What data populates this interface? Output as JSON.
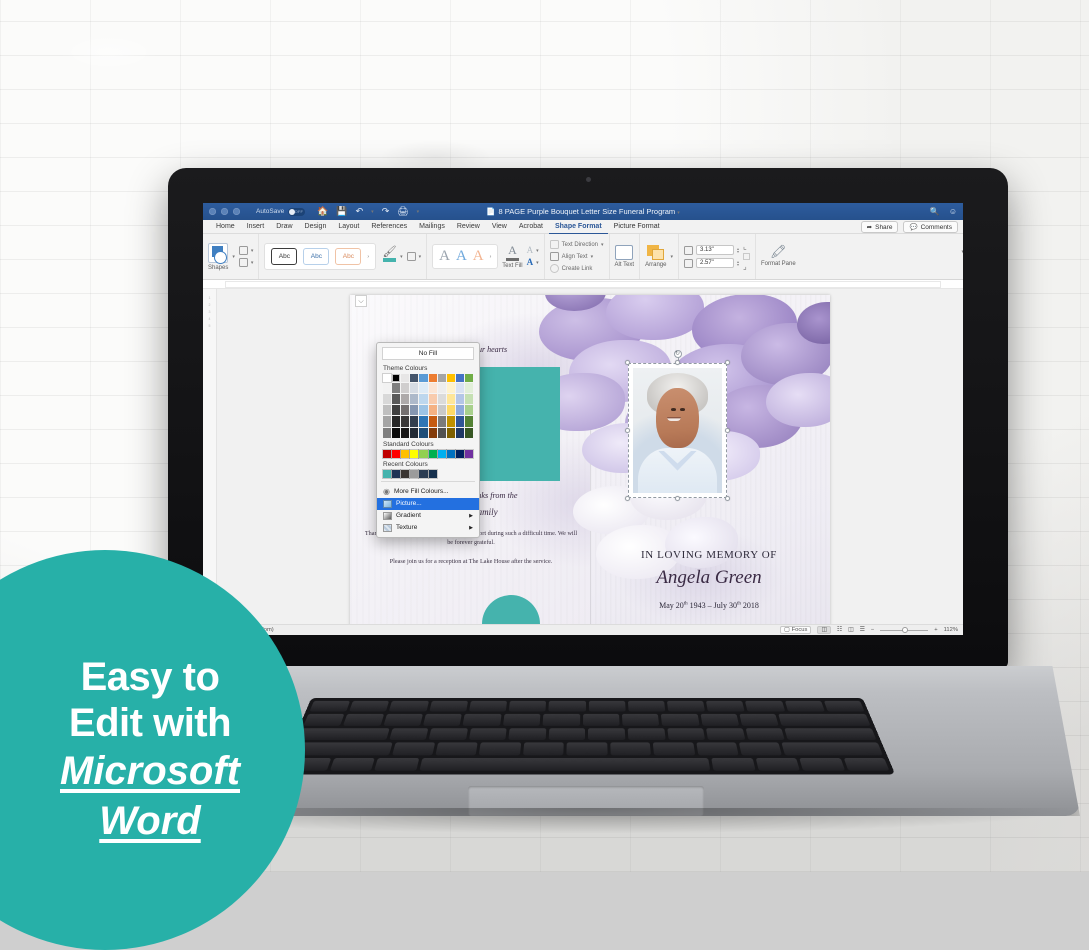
{
  "titlebar": {
    "autosave_label": "AutoSave",
    "autosave_state": "OFF",
    "document_title": "8 PAGE Purple Bouquet Letter Size Funeral Program",
    "doc_icon": "word-document-icon",
    "icons": [
      "home-icon",
      "save-icon",
      "undo-icon",
      "redo-icon",
      "print-icon",
      "customize-toolbar-icon"
    ],
    "search_icon": "search-icon",
    "account_icon": "account-icon"
  },
  "tabs": [
    {
      "label": "Home",
      "active": false
    },
    {
      "label": "Insert",
      "active": false
    },
    {
      "label": "Draw",
      "active": false
    },
    {
      "label": "Design",
      "active": false
    },
    {
      "label": "Layout",
      "active": false
    },
    {
      "label": "References",
      "active": false
    },
    {
      "label": "Mailings",
      "active": false
    },
    {
      "label": "Review",
      "active": false
    },
    {
      "label": "View",
      "active": false
    },
    {
      "label": "Acrobat",
      "active": false
    },
    {
      "label": "Shape Format",
      "active": true
    },
    {
      "label": "Picture Format",
      "active": false
    }
  ],
  "tabs_right": {
    "share_label": "Share",
    "share_icon": "share-icon",
    "comments_label": "Comments",
    "comments_icon": "comment-icon"
  },
  "ribbon": {
    "shapes_label": "Shapes",
    "edit_shape_icon": "edit-shape-icon",
    "text_box_icon": "text-box-icon",
    "shape_styles": [
      "Abc",
      "Abc",
      "Abc"
    ],
    "shape_fill_icon": "shape-fill-icon",
    "shape_outline_icon": "shape-outline-icon",
    "text_fill_label": "Text Fill",
    "wordart_letter": "A",
    "text_direction_label": "Text Direction",
    "align_text_label": "Align Text",
    "create_link_label": "Create Link",
    "alt_text_label": "Alt Text",
    "alt_text_icon": "alt-text-icon",
    "arrange_label": "Arrange",
    "arrange_icon": "arrange-icon",
    "height_value": "3.13\"",
    "width_value": "2.57\"",
    "height_icon": "shape-height-icon",
    "width_icon": "shape-width-icon",
    "format_pane_label": "Format Pane",
    "format_pane_icon": "format-pane-icon",
    "overflow_icon": "ribbon-overflow-icon"
  },
  "fill_menu": {
    "no_fill_label": "No Fill",
    "theme_colours_label": "Theme Colours",
    "standard_colours_label": "Standard Colours",
    "recent_colours_label": "Recent Colours",
    "theme_row": [
      "#ffffff",
      "#000000",
      "#e7e6e6",
      "#44546a",
      "#5b9bd5",
      "#ed7d31",
      "#a5a5a5",
      "#ffc000",
      "#4472c4",
      "#70ad47"
    ],
    "theme_shades": [
      [
        "#f2f2f2",
        "#7f7f7f",
        "#d0cece",
        "#d6dce4",
        "#deebf6",
        "#fbe5d5",
        "#ededed",
        "#fff2cc",
        "#d9e2f3",
        "#e2efd9"
      ],
      [
        "#d8d8d8",
        "#595959",
        "#aeaaaa",
        "#adb9ca",
        "#bdd7ee",
        "#f8cbad",
        "#dbdbdb",
        "#ffe698",
        "#b4c6e7",
        "#c5e0b3"
      ],
      [
        "#bfbfbf",
        "#3f3f3f",
        "#757070",
        "#8596b0",
        "#9cc3e5",
        "#f4b183",
        "#c9c9c9",
        "#ffd965",
        "#8eaadb",
        "#a8d08d"
      ],
      [
        "#a5a5a5",
        "#262626",
        "#3a3838",
        "#333f4f",
        "#2e75b5",
        "#c55a11",
        "#7b7b7b",
        "#bf9000",
        "#2f5496",
        "#538135"
      ],
      [
        "#7f7f7f",
        "#0c0c0c",
        "#171616",
        "#222a35",
        "#1f4e79",
        "#833c0b",
        "#525252",
        "#7f6000",
        "#1f3864",
        "#375623"
      ]
    ],
    "standard_row": [
      "#c00000",
      "#ff0000",
      "#ffc000",
      "#ffff00",
      "#92d050",
      "#00b050",
      "#00b0f0",
      "#0070c0",
      "#002060",
      "#7030a0"
    ],
    "recent_row": [
      "#45b3ad",
      "#1f3355",
      "#3a3531",
      "#9b9b9b",
      "#2b3c52",
      "#16304d"
    ],
    "items": [
      {
        "label": "More Fill Colours...",
        "icon": "color-wheel-icon",
        "selected": false,
        "submenu": false
      },
      {
        "label": "Picture...",
        "icon": "picture-icon",
        "selected": true,
        "submenu": false
      },
      {
        "label": "Gradient",
        "icon": "gradient-icon",
        "selected": false,
        "submenu": true
      },
      {
        "label": "Texture",
        "icon": "texture-icon",
        "selected": false,
        "submenu": true
      }
    ]
  },
  "document": {
    "hearts_text": "our hearts",
    "thanks_line1": "With special thanks from the",
    "thanks_line2": "Thomas family",
    "thanks_body": "Thank you so much for all your love and support during such a difficult time. We will be forever grateful.",
    "reception": "Please join us for a reception at The Lake House after the service.",
    "memory_heading": "IN LOVING MEMORY OF",
    "deceased_name": "Angela Green",
    "date_birth_month": "May 20",
    "date_birth_sup": "th",
    "date_birth_year": "1943",
    "dash": "–",
    "date_death_month": "July 30",
    "date_death_sup": "th",
    "date_death_year": "2018",
    "teal_accent": "#45b3ad",
    "portrait_alt": "portrait-photo-of-deceased"
  },
  "statusbar": {
    "language": "English (United Kingdom)",
    "focus_label": "Focus",
    "focus_icon": "focus-icon",
    "print_layout_icon": "print-layout-icon",
    "web_layout_icon": "web-layout-icon",
    "read_mode_icon": "read-mode-icon",
    "outline_icon": "outline-icon",
    "zoom_out": "−",
    "zoom_in": "+",
    "zoom_level": "112%"
  },
  "badge": {
    "line1": "Easy to",
    "line2": "Edit with",
    "line3": "Microsoft",
    "line4": "Word",
    "color": "#27b0a8"
  },
  "laptop": {
    "brand": "laptop-hinge"
  }
}
